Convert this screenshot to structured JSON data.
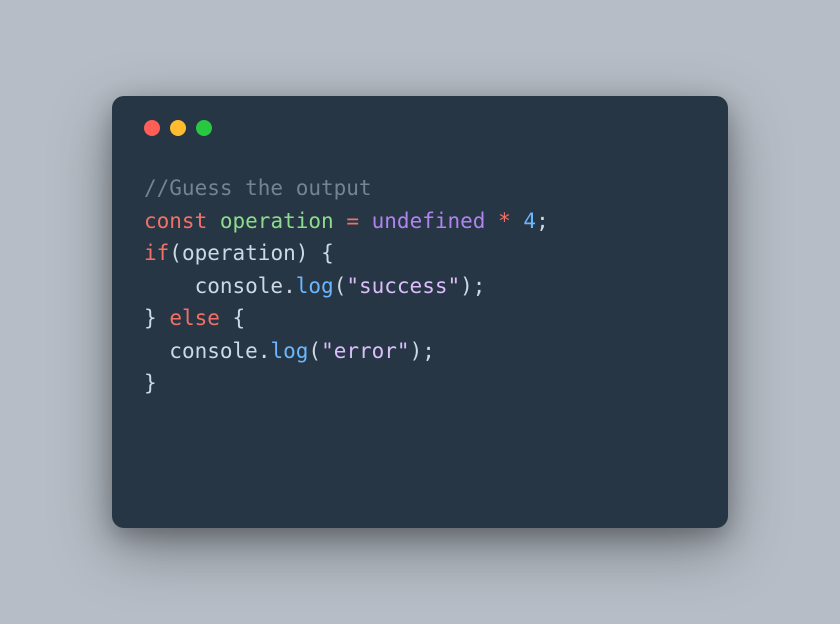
{
  "colors": {
    "background": "#b6bdc6",
    "window": "#263644",
    "red": "#ff5f57",
    "yellow": "#febc2e",
    "green": "#28c840"
  },
  "code": {
    "line1": {
      "comment": "//Guess the output"
    },
    "line2": {
      "kw_const": "const",
      "sp1": " ",
      "name": "operation",
      "sp2": " ",
      "eq": "=",
      "sp3": " ",
      "undef": "undefined",
      "sp4": " ",
      "mul": "*",
      "sp5": " ",
      "num": "4",
      "semi": ";"
    },
    "line3": {
      "kw_if": "if",
      "lp": "(",
      "name": "operation",
      "rp": ")",
      "sp": " ",
      "lb": "{"
    },
    "line4": {
      "indent": "    ",
      "obj": "console",
      "dot": ".",
      "fn": "log",
      "lp": "(",
      "str": "\"success\"",
      "rp": ")",
      "semi": ";"
    },
    "line5": {
      "rb": "}",
      "sp1": " ",
      "kw_else": "else",
      "sp2": " ",
      "lb": "{"
    },
    "line6": {
      "indent": "  ",
      "obj": "console",
      "dot": ".",
      "fn": "log",
      "lp": "(",
      "str": "\"error\"",
      "rp": ")",
      "semi": ";"
    },
    "line7": {
      "rb": "}"
    }
  }
}
